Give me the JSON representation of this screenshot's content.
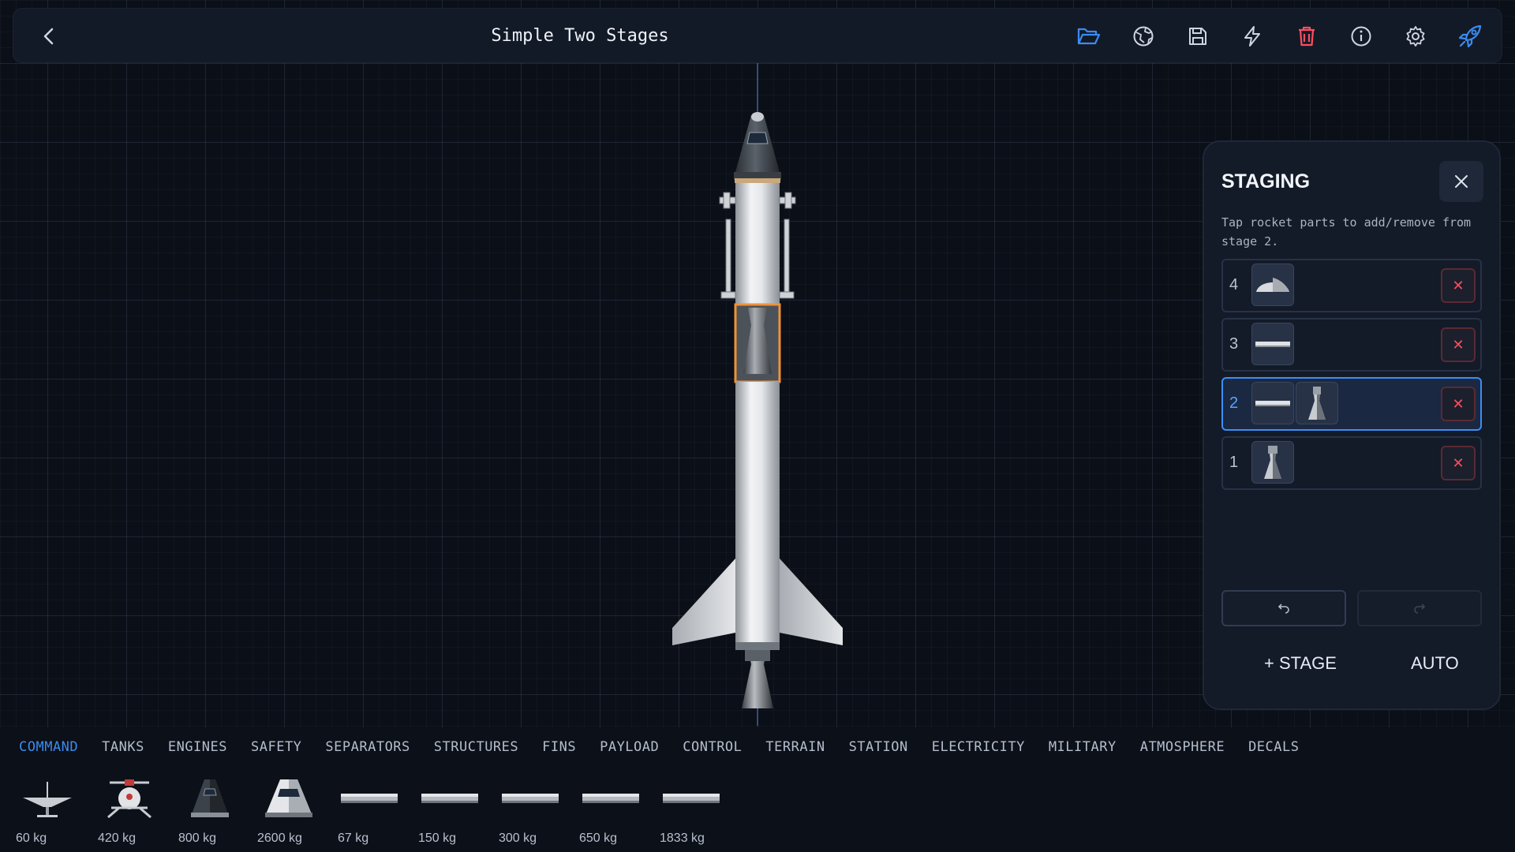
{
  "topbar": {
    "title": "Simple Two Stages",
    "icons": [
      "back-icon",
      "folder-open-icon",
      "globe-icon",
      "save-icon",
      "lightning-icon",
      "trash-icon",
      "info-icon",
      "gear-icon",
      "rocket-launch-icon"
    ],
    "accent": "#3a8cf0",
    "danger": "#ff4d5e"
  },
  "staging": {
    "title": "STAGING",
    "hint": "Tap rocket parts to add/remove from stage 2.",
    "stages": [
      {
        "num": "4",
        "parts": [
          "heat-shield"
        ],
        "active": false
      },
      {
        "num": "3",
        "parts": [
          "separator"
        ],
        "active": false
      },
      {
        "num": "2",
        "parts": [
          "separator",
          "engine"
        ],
        "active": true
      },
      {
        "num": "1",
        "parts": [
          "engine"
        ],
        "active": false
      }
    ],
    "undo_icon": "undo-icon",
    "redo_icon": "redo-icon",
    "add_stage": "+ STAGE",
    "auto": "AUTO"
  },
  "categories": [
    "COMMAND",
    "TANKS",
    "ENGINES",
    "SAFETY",
    "SEPARATORS",
    "STRUCTURES",
    "FINS",
    "PAYLOAD",
    "CONTROL",
    "TERRAIN",
    "STATION",
    "ELECTRICITY",
    "MILITARY",
    "ATMOSPHERE",
    "DECALS"
  ],
  "active_category": "COMMAND",
  "parts": [
    {
      "icon": "probe-dish-icon",
      "mass": "60 kg"
    },
    {
      "icon": "lander-pod-icon",
      "mass": "420 kg"
    },
    {
      "icon": "capsule-small-icon",
      "mass": "800 kg"
    },
    {
      "icon": "capsule-large-icon",
      "mass": "2600 kg"
    },
    {
      "icon": "bar-part-icon",
      "mass": "67 kg"
    },
    {
      "icon": "bar-part-icon",
      "mass": "150 kg"
    },
    {
      "icon": "bar-part-icon",
      "mass": "300 kg"
    },
    {
      "icon": "bar-part-icon",
      "mass": "650 kg"
    },
    {
      "icon": "bar-part-icon",
      "mass": "1833 kg"
    }
  ]
}
